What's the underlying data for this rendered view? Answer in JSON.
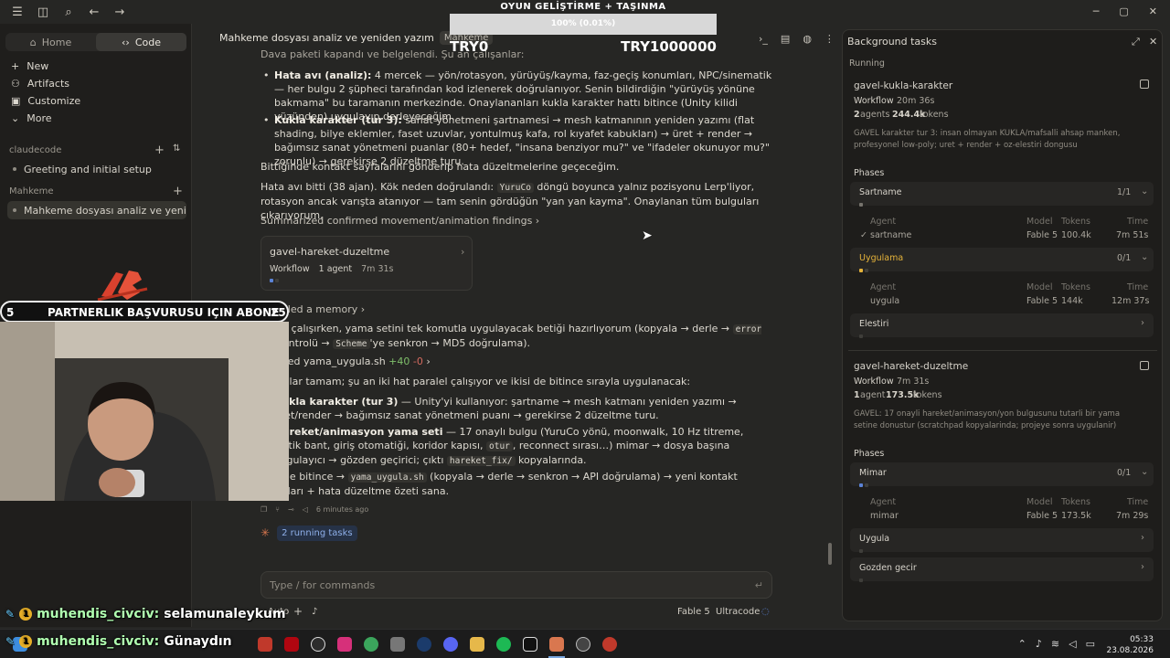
{
  "titlebar": {
    "icons": [
      "menu-icon",
      "sidebar-toggle-icon",
      "search-icon",
      "back-arrow-icon",
      "forward-arrow-icon"
    ],
    "window_controls": [
      "─",
      "▢",
      "✕"
    ]
  },
  "sidebar": {
    "tabs": [
      {
        "label": "Home",
        "icon": "home-icon"
      },
      {
        "label": "Code",
        "icon": "code-icon"
      }
    ],
    "nav": [
      {
        "label": "New",
        "icon": "plus-icon"
      },
      {
        "label": "Artifacts",
        "icon": "artifacts-icon"
      },
      {
        "label": "Customize",
        "icon": "customize-icon"
      },
      {
        "label": "More",
        "icon": "chevron-down-icon"
      }
    ],
    "section_claudecode": "claudecode",
    "item_greeting": "Greeting and initial setup",
    "section_mahkeme": "Mahkeme",
    "item_mahkeme": "Mahkeme dosyası analiz ve yeniden ya"
  },
  "main": {
    "title": "Mahkeme dosyası analiz ve yeniden yazım",
    "tag": "Mahkeme",
    "top_line": "Dava paketi kapandı ve belgelendi. Şu an çalışanlar:",
    "b1_head": "Hata avı (analiz):",
    "b1_text": " 4 mercek — yön/rotasyon, yürüyüş/kayma, faz-geçiş konumları, NPC/sinematik — her bulgu 2 şüpheci tarafından kod izlenerek doğrulanıyor. Senin bildirdiğin \"yürüyüş yönüne bakmama\" bu taramanın merkezinde. Onaylananları kukla karakter hattı bitince (Unity kilidi yüzünden) uygulayıp derleyeceğim.",
    "b2_head": "Kukla karakter (tur 3):",
    "b2_text": " sanat yönetmeni şartnamesi → mesh katmanının yeniden yazımı (flat shading, bilye eklemler, faset uzuvlar, yontulmuş kafa, rol kıyafet kabukları) → üret + render → bağımsız sanat yönetmeni puanlar (80+ hedef, \"insana benziyor mu?\" ve \"ifadeler okunuyor mu?\" zorunlu) → gerekirse 2 düzeltme turu.",
    "p1": "Bittiğinde kontakt sayfalarını gönderip hata düzeltmelerine geçeceğim.",
    "p2a": "Hata avı bitti (38 ajan). Kök neden doğrulandı: ",
    "p2code": "YuruCo",
    "p2b": " döngü boyunca yalnız pozisyonu Lerp'liyor, rotasyon ancak varışta atanıyor — tam senin gördüğün \"yan yan kayma\". Onaylanan tüm bulguları çıkarıyorum.",
    "summary_link": "Summarized confirmed movement/animation findings ›",
    "workflow_card": {
      "title": "gavel-hareket-duzeltme",
      "kind": "Workflow",
      "agents": "1 agent",
      "time": "7m 31s"
    },
    "memory_link": "Recalled a memory ›",
    "p3a": "O hat çalışırken, yama setini tek komutla uygulayacak betiği hazırlıyorum (kopyala → derle → ",
    "p3code1": "error CS",
    "p3b": " kontrolü → ",
    "p3code2": "Scheme",
    "p3c": "'ye senkron → MD5 doğrulama).",
    "file_line": "Created yama_uygula.sh",
    "file_add": "+40",
    "file_del": "-0",
    "p4": "Bulgular tamam; şu an iki hat paralel çalışıyor ve ikisi de bitince sırayla uygulanacak:",
    "b3_head": "Kukla karakter (tur 3)",
    "b3_text": " — Unity'yi kullanıyor: şartname → mesh katmanı yeniden yazımı → üret/render → bağımsız sanat yönetmeni puanı → gerekirse 2 düzeltme turu.",
    "b4_head": "Hareket/animasyon yama seti",
    "b4_text1": " — 17 onaylı bulgu (YuruCo yönü, moonwalk, 10 Hz titreme, lastik bant, giriş otomatiği, koridor kapısı, ",
    "b4_code1": "otur",
    "b4_text2": ", reconnect sırası…) mimar → dosya başına uygulayıcı → gözden geçirici; çıktı ",
    "b4_code2": "hareket_fix/",
    "b4_text3": " kopyalarında.",
    "p5a": "İkisi de bitince → ",
    "p5code": "yama_uygula.sh",
    "p5b": " (kopyala → derle → senkron → API doğrulama) → yeni kontakt sayfaları + hata düzeltme özeti sana.",
    "timestamp": "6 minutes ago",
    "running_tasks": "2 running tasks",
    "input_placeholder": "Type / for commands",
    "mode": "Auto",
    "model": "Fable 5",
    "effort": "Ultracode"
  },
  "panel": {
    "title": "Background tasks",
    "running_label": "Running",
    "task1": {
      "name": "gavel-kukla-karakter",
      "kind": "Workflow",
      "time": "20m 36s",
      "agents": "2",
      "agents_label": "agents",
      "tokens": "244.4k",
      "tokens_label": "tokens",
      "desc": "GAVEL karakter tur 3: insan olmayan KUKLA/mafsalli ahsap manken, profesyonel low-poly; uret + render + oz-elestiri dongusu",
      "phases_label": "Phases",
      "phase1": {
        "name": "Sartname",
        "count": "1/1",
        "agent": "sartname",
        "model": "Fable 5",
        "tokens": "100.4k",
        "time": "7m 51s"
      },
      "phase2": {
        "name": "Uygulama",
        "count": "0/1",
        "agent": "uygula",
        "model": "Fable 5",
        "tokens": "144k",
        "time": "12m 37s"
      },
      "phase3": {
        "name": "Elestiri"
      }
    },
    "task2": {
      "name": "gavel-hareket-duzeltme",
      "kind": "Workflow",
      "time": "7m 31s",
      "agents": "1",
      "agents_label": "agent",
      "tokens": "173.5k",
      "tokens_label": "tokens",
      "desc": "GAVEL: 17 onayli hareket/animasyon/yon bulgusunu tutarli bir yama setine donustur (scratchpad kopyalarinda; projeye sonra uygulanir)",
      "phases_label": "Phases",
      "phase1": {
        "name": "Mimar",
        "count": "0/1",
        "agent": "mimar",
        "model": "Fable 5",
        "tokens": "173.5k",
        "time": "7m 29s"
      },
      "phase2": {
        "name": "Uygula"
      },
      "phase3": {
        "name": "Gozden gecir"
      }
    },
    "col_agent": "Agent",
    "col_model": "Model",
    "col_tokens": "Tokens",
    "col_time": "Time"
  },
  "overlay": {
    "game_title": "OYUN GELİŞTİRME + TAŞINMA",
    "game_progress_text": "100% (0.01%)",
    "game_progress": 0.01,
    "game_left": "TRY0",
    "game_right": "TRY1000000",
    "partner_left": "5",
    "partner_text": "PARTNERLIK BAŞVURUSU IÇIN ABONE",
    "partner_right": "25",
    "chat1_user": "muhendis_civciv:",
    "chat1_msg": "selamunaleykum",
    "chat2_user": "muhendis_civciv:",
    "chat2_msg": "Günaydın"
  },
  "taskbar": {
    "time": "05:33",
    "date": "23.08.2026",
    "apps": [
      "windows-icon",
      "search-icon",
      "pdf-icon",
      "netflix-icon",
      "chatgpt-icon",
      "instagram-icon",
      "chrome-icon",
      "files-icon",
      "steam-icon",
      "discord-icon",
      "folder-icon",
      "spotify-icon",
      "x-icon",
      "claude-icon",
      "settings-icon",
      "app-icon"
    ]
  }
}
